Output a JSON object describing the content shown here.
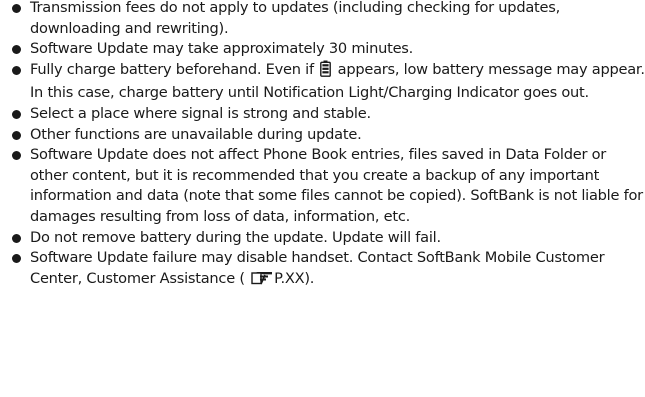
{
  "notes": {
    "items": [
      {
        "text": "Transmission fees do not apply to updates (including checking for updates, downloading and rewriting)."
      },
      {
        "text": "Software Update may take approximately 30 minutes."
      },
      {
        "before": "Fully charge battery beforehand. Even if",
        "icon": "battery-icon",
        "after": "appears, low battery message may appear. In this case, charge battery until Notification Light/Charging Indicator goes out."
      },
      {
        "text": "Select a place where signal is strong and stable."
      },
      {
        "text": "Other functions are unavailable during update."
      },
      {
        "text": "Software Update does not affect Phone Book entries, files saved in Data Folder or other content, but it is recommended that you create a backup of any important information and data (note that some files cannot be copied). SoftBank is not liable for damages resulting from loss of data, information, etc."
      },
      {
        "text": "Do not remove battery during the update. Update will fail."
      },
      {
        "before": "Software Update failure may disable handset. Contact SoftBank Mobile Customer Center, Customer Assistance (",
        "icon": "page-reference-icon",
        "after": "P.XX)."
      }
    ]
  },
  "colors": {
    "text": "#1a1a1a",
    "background": "#ffffff"
  }
}
